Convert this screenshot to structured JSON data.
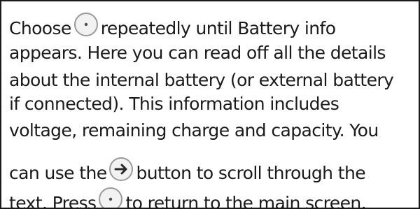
{
  "instructions": {
    "line1_a": "Choose",
    "line1_b": "repeatedly until Battery info",
    "line2": "appears. Here you can read off all the details",
    "line3": "about the internal battery (or external battery",
    "line4": "if connected). This information includes",
    "line5": "voltage, remaining charge and capacity. You",
    "line6_a": "can use the",
    "line6_b": "button to scroll through the",
    "line7_a": "text. Press",
    "line7_b": "to return to the main screen."
  },
  "icons": {
    "select_button": "select-button-icon",
    "scroll_button": "arrow-right-button-icon"
  },
  "colors": {
    "text": "#1a1a1a",
    "icon_outline": "#9a9a9a",
    "icon_fill": "#f2f2f2"
  }
}
